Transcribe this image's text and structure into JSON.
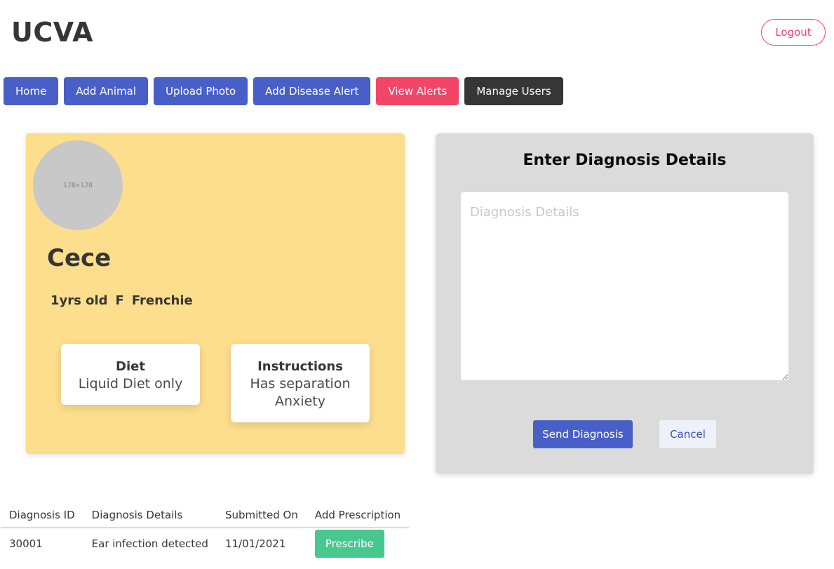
{
  "app": {
    "title": "UCVA",
    "logout_label": "Logout"
  },
  "nav": {
    "items": [
      {
        "label": "Home"
      },
      {
        "label": "Add Animal"
      },
      {
        "label": "Upload Photo"
      },
      {
        "label": "Add Disease Alert"
      },
      {
        "label": "View Alerts"
      },
      {
        "label": "Manage Users"
      }
    ]
  },
  "animal": {
    "avatar_placeholder": "128×128",
    "name": "Cece",
    "age": "1yrs old",
    "sex": "F",
    "breed": "Frenchie",
    "diet": {
      "title": "Diet",
      "value": "Liquid Diet only"
    },
    "instructions": {
      "title": "Instructions",
      "value": "Has separation Anxiety"
    }
  },
  "diagnosis_form": {
    "title": "Enter Diagnosis Details",
    "placeholder": "Diagnosis Details",
    "send_label": "Send Diagnosis",
    "cancel_label": "Cancel"
  },
  "diagnosis_table": {
    "headers": [
      "Diagnosis ID",
      "Diagnosis Details",
      "Submitted On",
      "Add Prescription"
    ],
    "rows": [
      {
        "id": "30001",
        "details": "Ear infection detected",
        "submitted_on": "11/01/2021",
        "action_label": "Prescribe"
      }
    ]
  },
  "colors": {
    "primary": "#485fc7",
    "danger": "#f14668",
    "dark": "#363636",
    "success": "#48c78e",
    "card_yellow": "#fcde8c",
    "panel_grey": "#dbdbdb"
  }
}
